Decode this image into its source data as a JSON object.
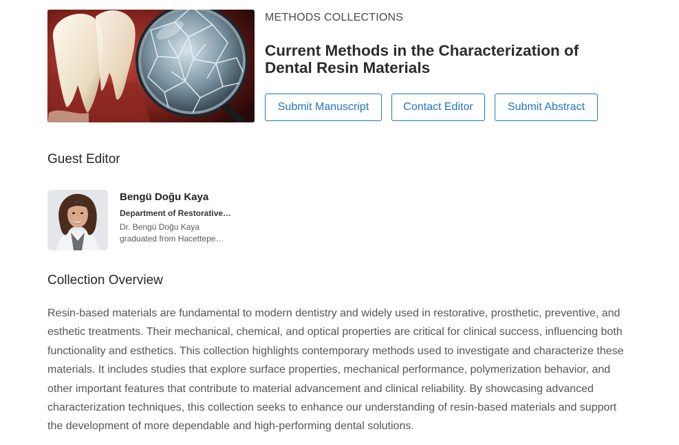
{
  "collection": {
    "kicker": "METHODS COLLECTIONS",
    "title_lines": [
      "Current Methods in the Characterization of",
      "Dental Resin Materials"
    ],
    "hero_image": "teeth-magnifier-crystals-illustration"
  },
  "actions": {
    "submit_manuscript": "Submit Manuscript",
    "contact_editor": "Contact Editor",
    "submit_abstract": "Submit Abstract"
  },
  "guest_editor": {
    "heading": "Guest Editor",
    "name": "Bengü Doğu Kaya",
    "department": "Department of Restorative…",
    "bio_lines": [
      "Dr. Bengü Doğu Kaya",
      "graduated from Hacettepe…"
    ]
  },
  "overview": {
    "heading": "Collection Overview",
    "lines": [
      "Resin-based materials are fundamental to modern dentistry and widely used in restorative, prosthetic, preventive, and",
      "esthetic treatments. Their mechanical, chemical, and optical properties are critical for clinical success, influencing both",
      "functionality and esthetics. This collection highlights contemporary methods used to investigate and characterize these",
      "materials. It includes studies that explore surface properties, mechanical performance, polymerization behavior, and",
      "other important features that contribute to material advancement and clinical reliability. By showcasing advanced",
      "characterization techniques, this collection seeks to enhance our understanding of resin-based materials and support",
      "the development of more dependable and high-performing dental solutions."
    ]
  },
  "colors": {
    "accent": "#1f74c1",
    "heading": "#262626",
    "body_text": "#555555"
  }
}
